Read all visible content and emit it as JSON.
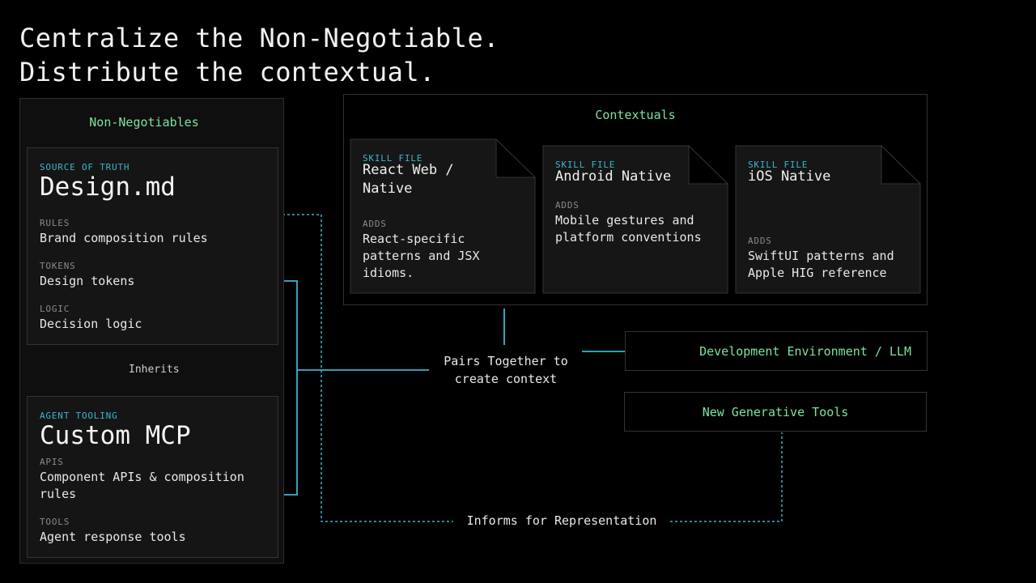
{
  "title": {
    "line1": "Centralize the Non-Negotiable.",
    "line2": "Distribute the contextual."
  },
  "non_negotiables": {
    "heading": "Non-Negotiables",
    "design": {
      "kicker": "SOURCE OF TRUTH",
      "name": "Design.md",
      "items": [
        {
          "label": "RULES",
          "value": "Brand composition rules"
        },
        {
          "label": "TOKENS",
          "value": "Design tokens"
        },
        {
          "label": "LOGIC",
          "value": "Decision logic"
        }
      ]
    },
    "inherits": "Inherits",
    "mcp": {
      "kicker": "AGENT TOOLING",
      "name": "Custom MCP",
      "items": [
        {
          "label": "APIS",
          "value": "Component APIs & composition rules"
        },
        {
          "label": "TOOLS",
          "value": "Agent response tools"
        }
      ]
    }
  },
  "contextuals": {
    "heading": "Contextuals",
    "skills": [
      {
        "kicker": "SKILL FILE",
        "name": "React Web / Native",
        "adds_label": "ADDS",
        "adds": "React-specific patterns and JSX idioms."
      },
      {
        "kicker": "SKILL FILE",
        "name": "Android Native",
        "adds_label": "ADDS",
        "adds": "Mobile gestures and platform conventions"
      },
      {
        "kicker": "SKILL FILE",
        "name": "iOS Native",
        "adds_label": "ADDS",
        "adds": "SwiftUI patterns and Apple HIG reference"
      }
    ]
  },
  "pairs_label": "Pairs Together to create context",
  "dev_env": "Development Environment / LLM",
  "gen_tools": "New Generative Tools",
  "informs_label": "Informs for Representation",
  "colors": {
    "accent_green": "#7ee2a0",
    "accent_teal": "#38b6cf",
    "background": "#000000"
  }
}
